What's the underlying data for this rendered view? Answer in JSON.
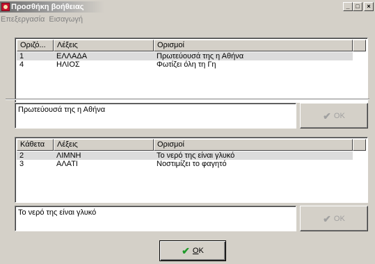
{
  "window": {
    "title": "Προσθήκη βοήθειας",
    "minimize_label": "_",
    "maximize_label": "□",
    "close_label": "×"
  },
  "menu": [
    "Επεξεργασία",
    "Εισαγωγή"
  ],
  "across": {
    "columns": [
      "Οριζό...",
      "Λέξεις",
      "Ορισμοί"
    ],
    "rows": [
      {
        "num": "1",
        "word": "ΕΛΛΑΔΑ",
        "definition": "Πρωτεύουσά της η Αθήνα",
        "selected": true
      },
      {
        "num": "4",
        "word": "ΗΛΙΟΣ",
        "definition": "Φωτίζει όλη τη Γη",
        "selected": false
      }
    ],
    "definition_text": "Πρωτεύουσά της η Αθήνα",
    "ok_label": "OK"
  },
  "down": {
    "columns": [
      "Κάθετα",
      "Λέξεις",
      "Ορισμοί"
    ],
    "rows": [
      {
        "num": "2",
        "word": "ΛΙΜΝΗ",
        "definition": "Το νερό της είναι γλυκό",
        "selected": true
      },
      {
        "num": "3",
        "word": "ΑΛΑΤΙ",
        "definition": "Νοστιμίζει το φαγητό",
        "selected": false
      }
    ],
    "definition_text": "Το νερό της είναι γλυκό",
    "ok_label": "OK"
  },
  "main_ok": {
    "mnemonic": "O",
    "rest": "K"
  },
  "icons": {
    "check": "check-icon",
    "app": "app-icon"
  }
}
